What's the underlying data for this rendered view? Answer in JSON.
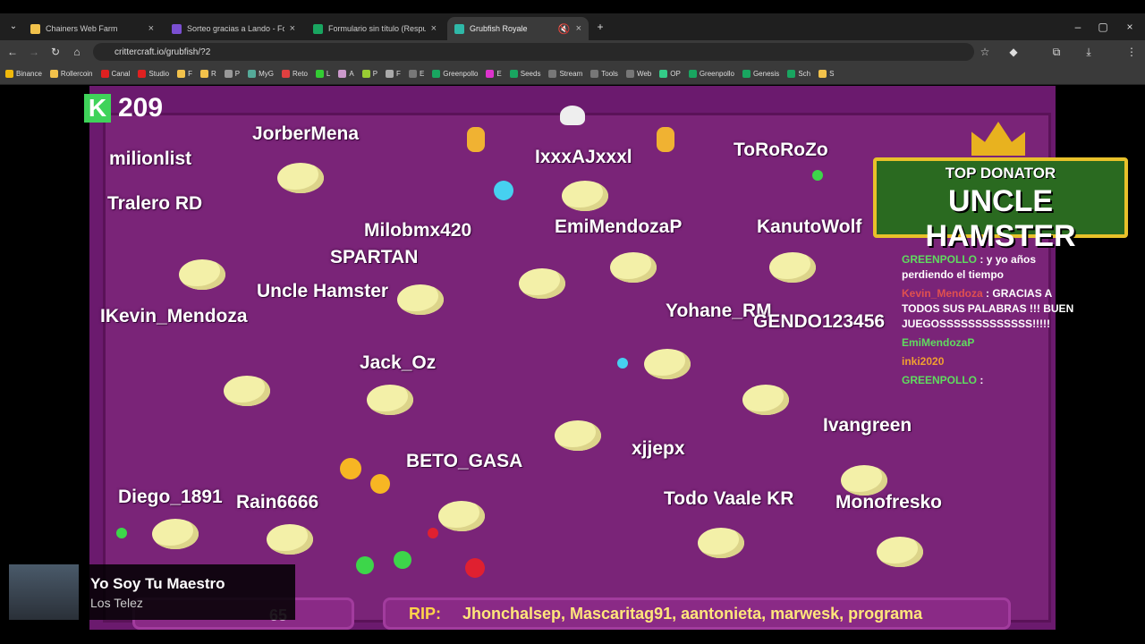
{
  "tabs": [
    {
      "title": "Chainers Web Farm",
      "color": "#f2c24b"
    },
    {
      "title": "Sorteo gracias a Lando - Formu",
      "color": "#7a4fd1"
    },
    {
      "title": "Formulario sin título (Respuesta",
      "color": "#19a560"
    },
    {
      "title": "Grubfish Royale",
      "color": "#2fb8a8"
    }
  ],
  "url": "crittercraft.io/grubfish/?2",
  "bookmarks": [
    "Binance",
    "Rollercoin",
    "Canal",
    "Studio",
    "F",
    "R",
    "P",
    "MyG",
    "Reto",
    "L",
    "A",
    "P",
    "F",
    "E",
    "Greenpollo",
    "E",
    "Seeds",
    "Stream",
    "Tools",
    "Web",
    "OP",
    "Greenpollo",
    "Genesis",
    "Sch",
    "S"
  ],
  "score": "209",
  "banner": {
    "line1": "TOP DONATOR",
    "line2": "UNCLE HAMSTER"
  },
  "players": [
    "JorberMena",
    "IxxxAJxxxl",
    "ToRoRoZo",
    "Milobmx420",
    "EmiMendozaP",
    "KanutoWolf",
    "SPARTAN",
    "Uncle Hamster",
    "Yohane_RM",
    "GENDO123456",
    "IKevin_Mendoza",
    "Jack_Oz",
    "Tralero RD",
    "BETO_GASA",
    "Diego_1891",
    "Rain6666",
    "Todo Vaale KR",
    "Monofresko",
    "xjjepx",
    "Ivangreen",
    "milionlist"
  ],
  "chat": [
    {
      "user": "GREENPOLLO",
      "msg": ": y yo años perdiendo el tiempo",
      "red": false
    },
    {
      "user": "Kevin_Mendoza",
      "msg": ": GRACIAS A TODOS SUS PALABRAS !!! BUEN JUEGOSSSSSSSSSSSSS!!!!!",
      "red": true
    },
    {
      "user": "EmiMendozaP",
      "msg": "",
      "red": false
    },
    {
      "user": "inki2020",
      "msg": "",
      "red": false
    },
    {
      "user": "GREENPOLLO",
      "msg": ":",
      "red": false
    }
  ],
  "rip": {
    "label": "RIP:",
    "names": "Jhonchalsep, Mascaritag91, aantonieta, marwesk, programa"
  },
  "leftbar": "65",
  "music": {
    "song": "Yo Soy Tu Maestro",
    "artist": "Los Telez"
  }
}
